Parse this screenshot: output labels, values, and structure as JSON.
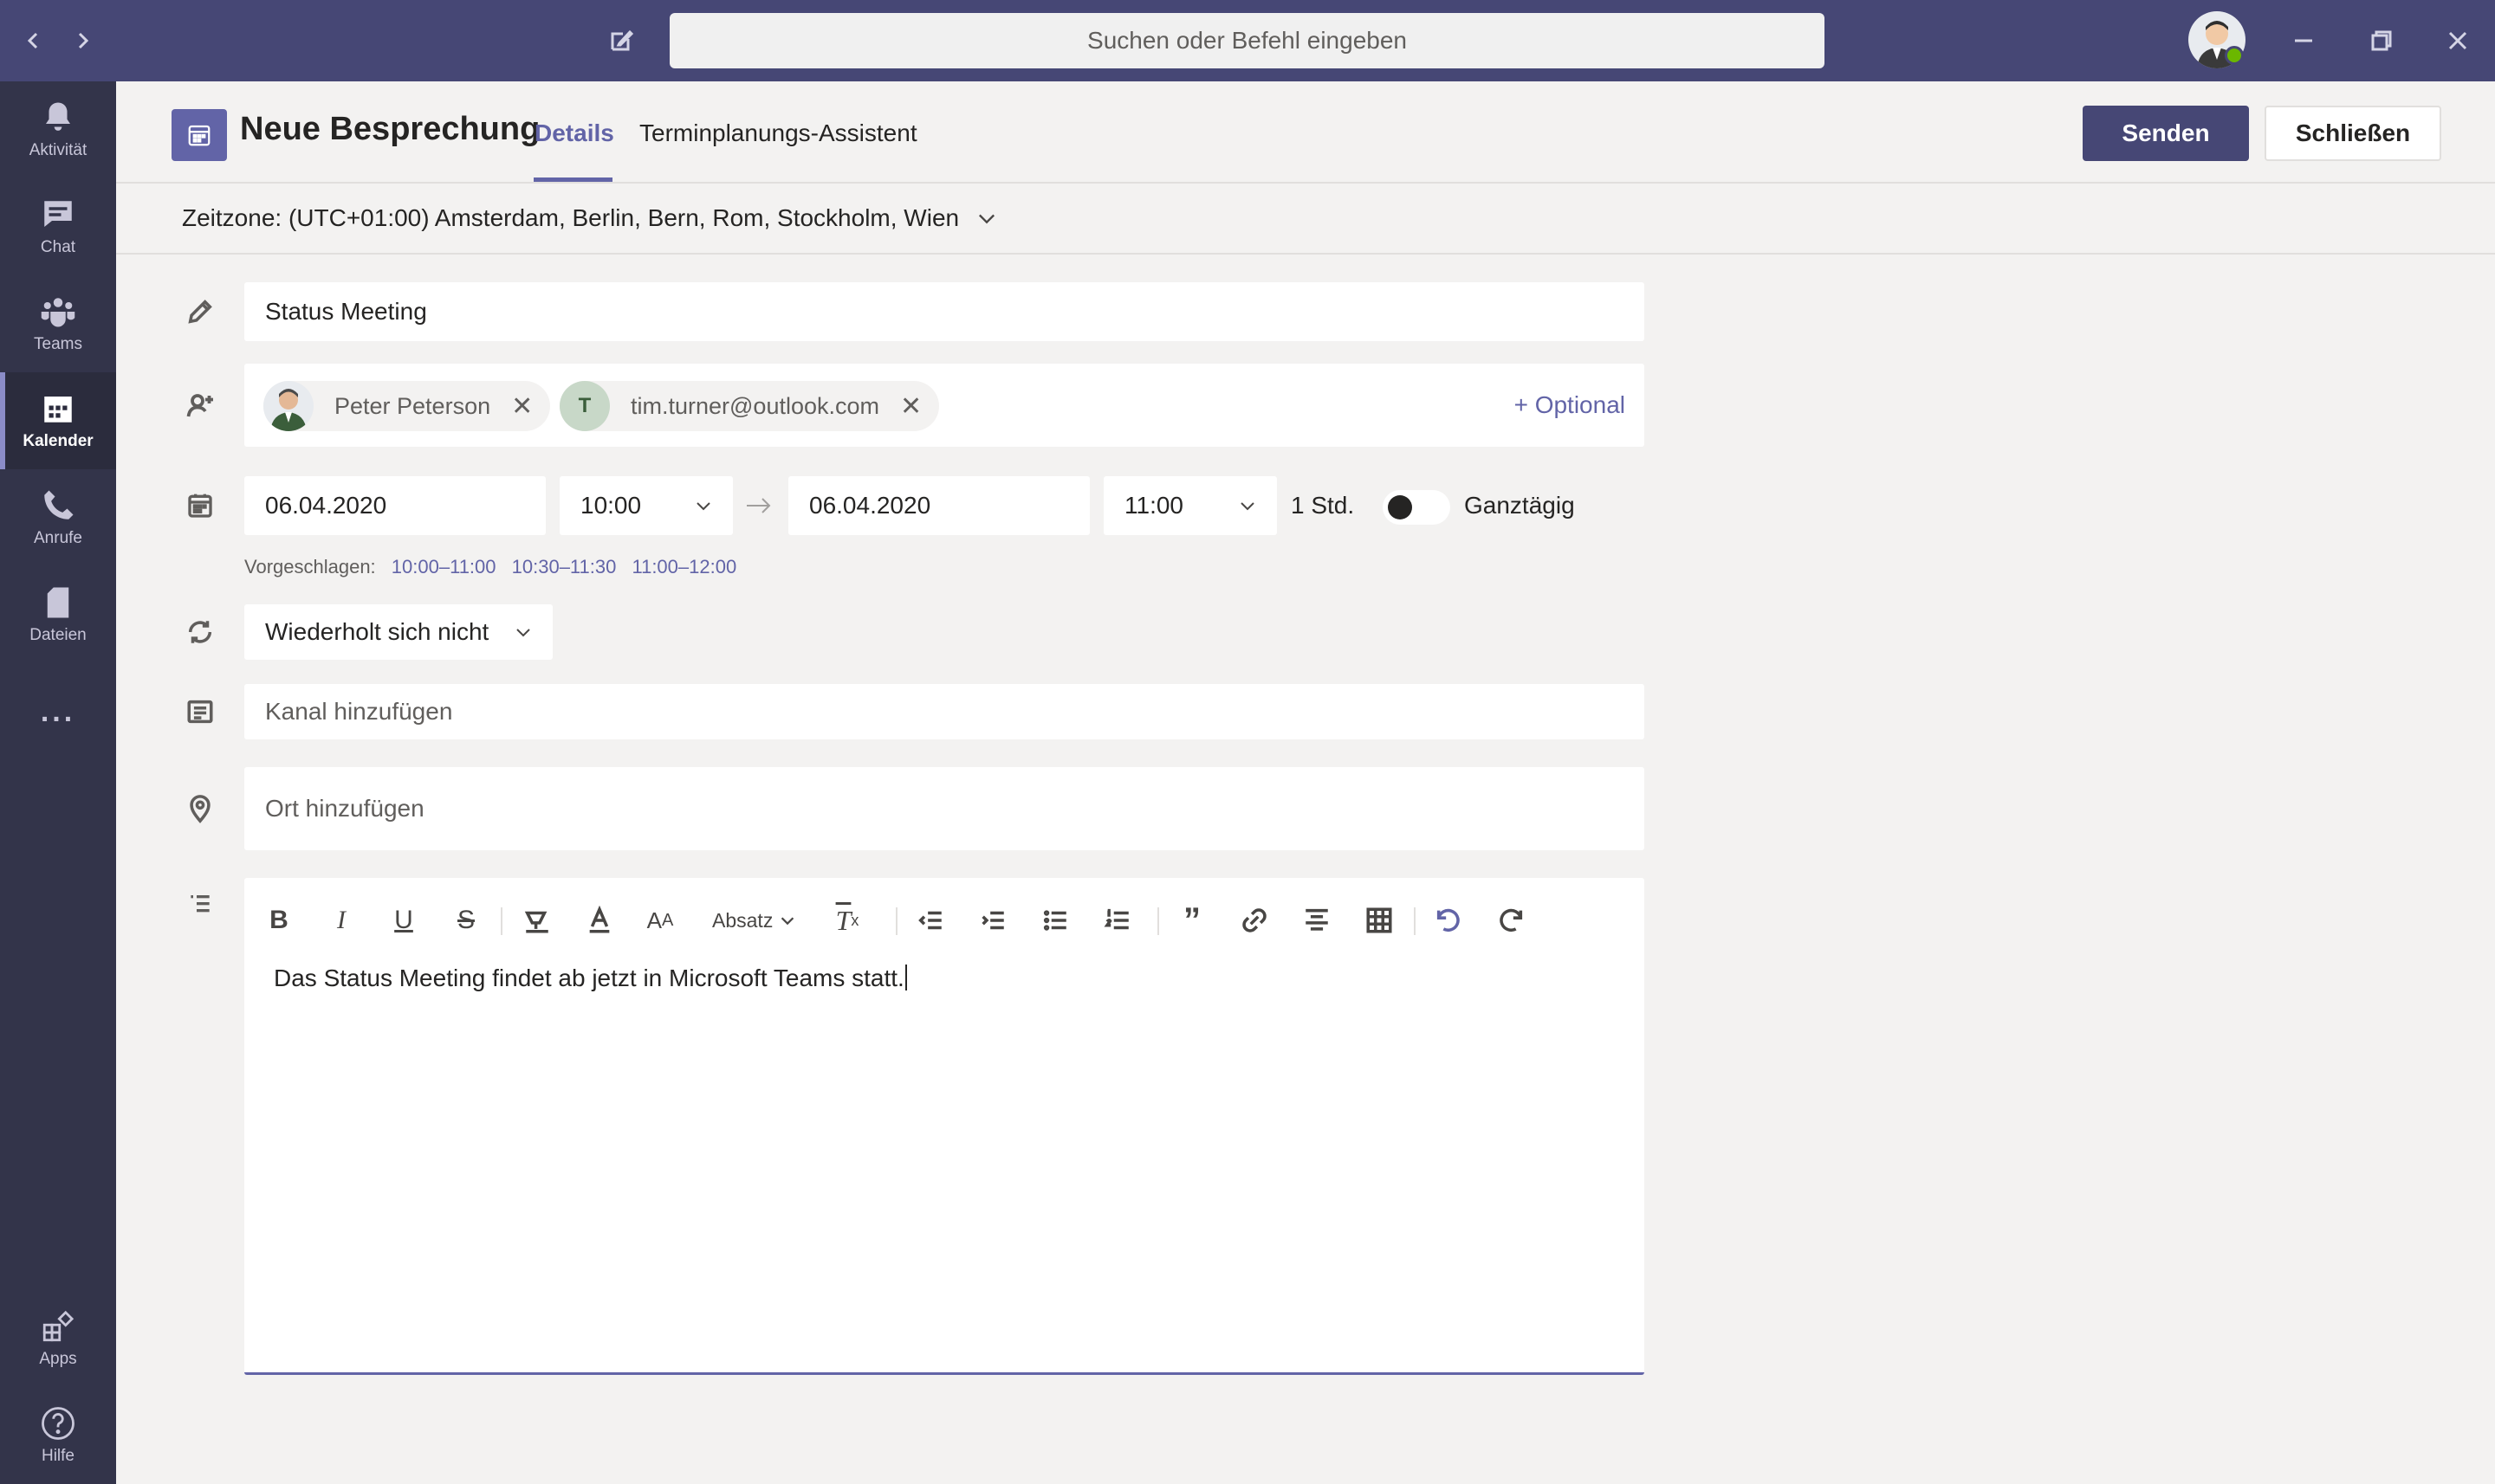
{
  "titlebar": {
    "search_placeholder": "Suchen oder Befehl eingeben"
  },
  "rail": {
    "items": [
      {
        "label": "Aktivität",
        "icon": "bell-icon"
      },
      {
        "label": "Chat",
        "icon": "chat-icon"
      },
      {
        "label": "Teams",
        "icon": "teams-icon"
      },
      {
        "label": "Kalender",
        "icon": "calendar-icon",
        "active": true
      },
      {
        "label": "Anrufe",
        "icon": "phone-icon"
      },
      {
        "label": "Dateien",
        "icon": "file-icon"
      },
      {
        "label": "...",
        "icon": "more-icon"
      }
    ],
    "bottom": [
      {
        "label": "Apps",
        "icon": "apps-icon"
      },
      {
        "label": "Hilfe",
        "icon": "help-icon"
      }
    ]
  },
  "header": {
    "title": "Neue Besprechung",
    "tabs": [
      {
        "label": "Details",
        "active": true
      },
      {
        "label": "Terminplanungs-Assistent"
      }
    ],
    "send_label": "Senden",
    "close_label": "Schließen"
  },
  "timezone": "Zeitzone: (UTC+01:00) Amsterdam, Berlin, Bern, Rom, Stockholm, Wien",
  "form": {
    "title_value": "Status Meeting",
    "attendees": [
      {
        "name": "Peter Peterson",
        "type": "photo"
      },
      {
        "name": "tim.turner@outlook.com",
        "initial": "T"
      }
    ],
    "optional_label": "+ Optional",
    "start_date": "06.04.2020",
    "start_time": "10:00",
    "end_date": "06.04.2020",
    "end_time": "11:00",
    "duration": "1 Std.",
    "allday_label": "Ganztägig",
    "suggested_label": "Vorgeschlagen:",
    "suggested_slots": [
      "10:00–11:00",
      "10:30–11:30",
      "11:00–12:00"
    ],
    "repeat_value": "Wiederholt sich nicht",
    "channel_placeholder": "Kanal hinzufügen",
    "location_placeholder": "Ort hinzufügen"
  },
  "editor": {
    "paragraph_label": "Absatz",
    "body_text": "Das Status Meeting findet ab jetzt in Microsoft Teams statt."
  },
  "colors": {
    "titlebar": "#464775",
    "rail": "#33344a",
    "accent": "#6264a7",
    "presence": "#6bb700"
  }
}
